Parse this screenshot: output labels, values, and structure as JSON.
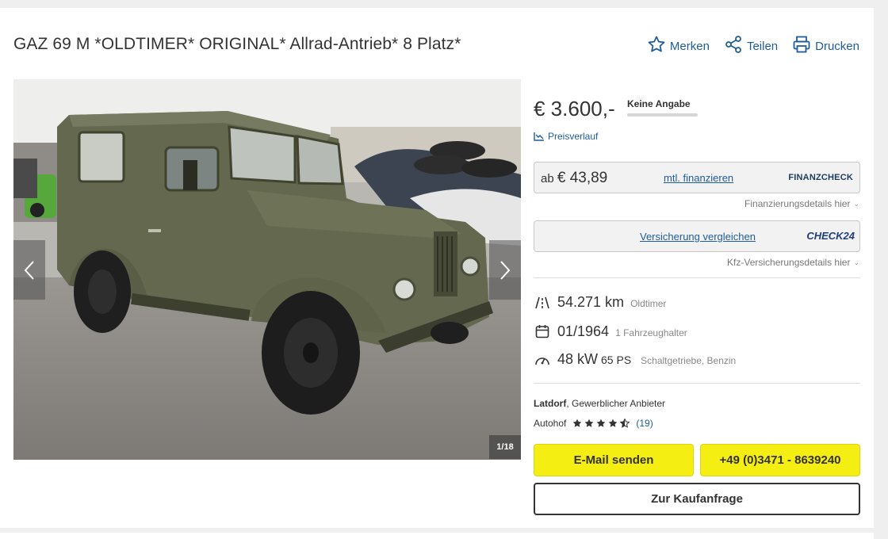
{
  "listing": {
    "title": "GAZ 69 M *OLDTIMER* ORIGINAL* Allrad-Antrieb* 8 Platz*"
  },
  "actions": {
    "save_label": "Merken",
    "share_label": "Teilen",
    "print_label": "Drucken"
  },
  "gallery": {
    "counter": "1/18",
    "prev_icon": "chevron-left-icon",
    "next_icon": "chevron-right-icon"
  },
  "price": {
    "value": "€ 3.600,-",
    "rating": "Keine Angabe",
    "history_label": "Preisverlauf"
  },
  "financing": {
    "prefix": "ab",
    "amount": "€ 43,89",
    "link": "mtl. finanzieren",
    "brand": "FINANZCHECK",
    "details": "Finanzierungsdetails hier"
  },
  "insurance": {
    "link": "Versicherung vergleichen",
    "brand": "CHECK24",
    "details": "Kfz-Versicherungsdetails hier"
  },
  "specs": {
    "mileage": "54.271 km",
    "category": "Oldtimer",
    "registration": "01/1964",
    "owners": "1 Fahrzeughalter",
    "power_kw": "48 kW",
    "power_ps": "65 PS",
    "transmission_fuel": "Schaltgetriebe, Benzin"
  },
  "seller": {
    "city": "Latdorf",
    "type": ", Gewerblicher Anbieter",
    "name": "Autohof",
    "rating_stars": 4.5,
    "reviews": "(19)"
  },
  "buttons": {
    "email": "E-Mail senden",
    "phone": "+49 (0)3471 - 8639240",
    "purchase_request": "Zur Kaufanfrage"
  },
  "colors": {
    "link": "#1f5c99",
    "cta_yellow": "#f5ee12",
    "text": "#333333"
  }
}
